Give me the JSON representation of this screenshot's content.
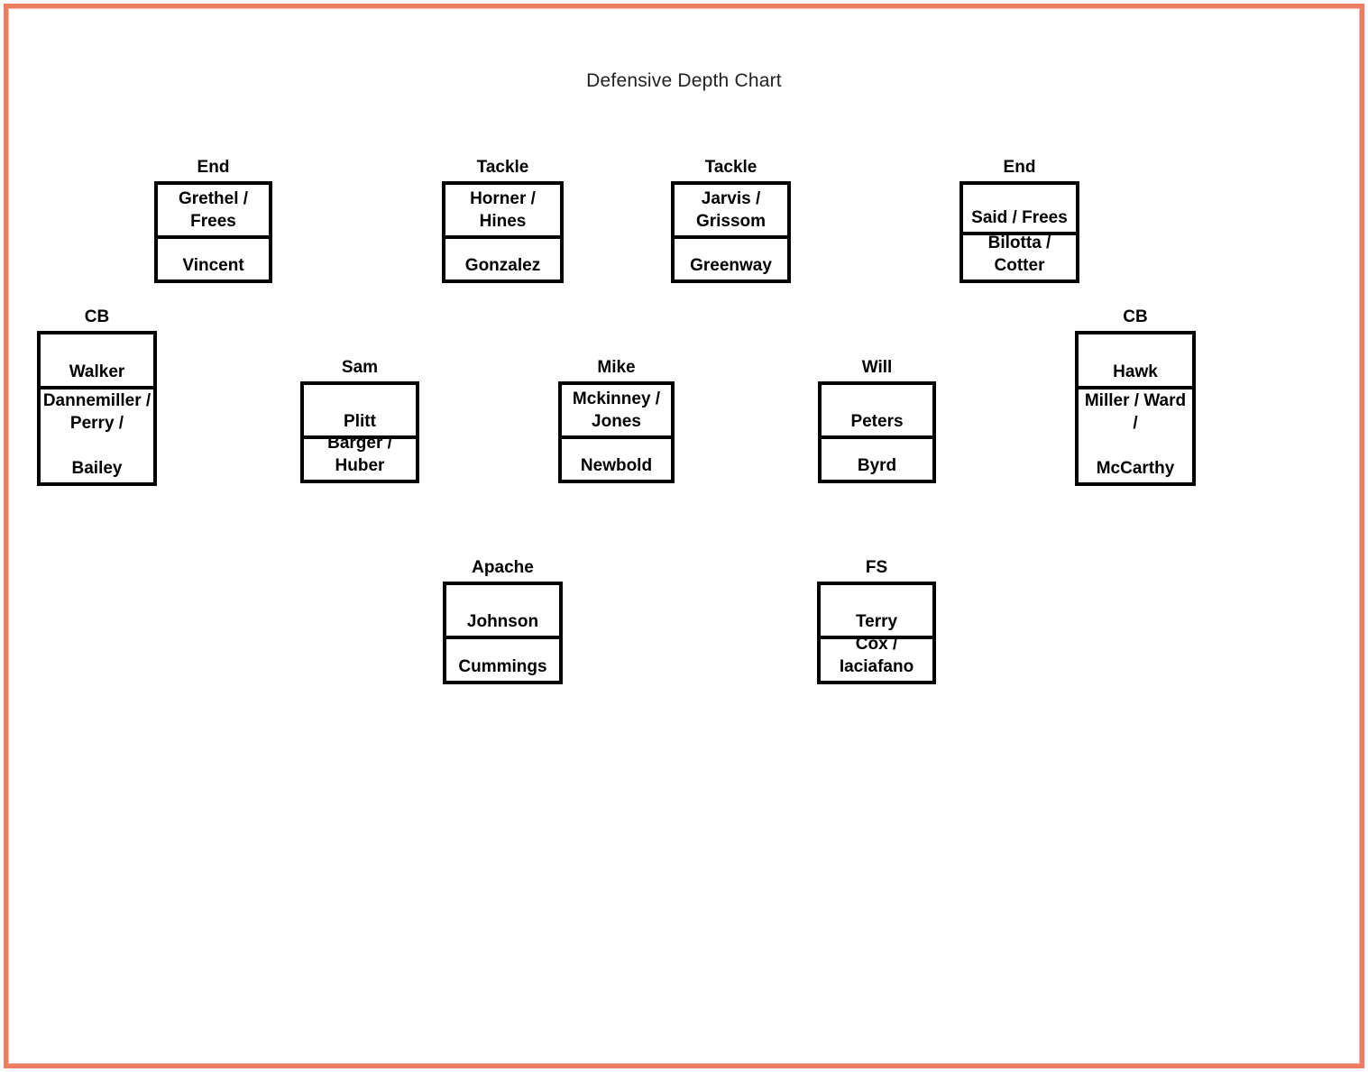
{
  "page": {
    "title": "Defensive Depth Chart",
    "frame_color": "#ed7d5f",
    "background": "#ffffff",
    "box_border_color": "#000000"
  },
  "groups": [
    {
      "name": "left-end",
      "label": "End",
      "cells": [
        {
          "lines": [
            "Grethel /",
            "Frees"
          ]
        },
        {
          "lines": [
            "",
            "Vincent"
          ]
        }
      ]
    },
    {
      "name": "left-tackle",
      "label": "Tackle",
      "cells": [
        {
          "lines": [
            "Horner /",
            "Hines"
          ]
        },
        {
          "lines": [
            "",
            "Gonzalez"
          ]
        }
      ]
    },
    {
      "name": "right-tackle",
      "label": "Tackle",
      "cells": [
        {
          "lines": [
            "Jarvis /",
            "Grissom"
          ]
        },
        {
          "lines": [
            "",
            "Greenway"
          ]
        }
      ]
    },
    {
      "name": "right-end",
      "label": "End",
      "cells": [
        {
          "lines": [
            "",
            "Said / Frees"
          ]
        },
        {
          "lines": [
            "Bilotta /",
            "Cotter"
          ]
        }
      ]
    },
    {
      "name": "left-cb",
      "label": "CB",
      "cells": [
        {
          "lines": [
            "",
            "Walker"
          ]
        },
        {
          "lines": [
            "Dannemiller /",
            "Perry /",
            "",
            "Bailey"
          ]
        }
      ]
    },
    {
      "name": "sam-linebacker",
      "label": "Sam",
      "cells": [
        {
          "lines": [
            "",
            "Plitt"
          ]
        },
        {
          "lines": [
            "Barger /",
            "Huber"
          ]
        }
      ]
    },
    {
      "name": "mike-linebacker",
      "label": "Mike",
      "cells": [
        {
          "lines": [
            "Mckinney /",
            "Jones"
          ]
        },
        {
          "lines": [
            "",
            "Newbold"
          ]
        }
      ]
    },
    {
      "name": "will-linebacker",
      "label": "Will",
      "cells": [
        {
          "lines": [
            "",
            "Peters"
          ]
        },
        {
          "lines": [
            "",
            "Byrd"
          ]
        }
      ]
    },
    {
      "name": "right-cb",
      "label": "CB",
      "cells": [
        {
          "lines": [
            "",
            "Hawk"
          ]
        },
        {
          "lines": [
            "Miller / Ward",
            "/",
            "",
            "McCarthy"
          ]
        }
      ]
    },
    {
      "name": "apache-safety",
      "label": "Apache",
      "cells": [
        {
          "lines": [
            "",
            "Johnson"
          ]
        },
        {
          "lines": [
            "",
            "Cummings"
          ]
        }
      ]
    },
    {
      "name": "free-safety",
      "label": "FS",
      "cells": [
        {
          "lines": [
            "",
            "Terry"
          ]
        },
        {
          "lines": [
            "Cox /",
            "Iaciafano"
          ]
        }
      ]
    }
  ]
}
